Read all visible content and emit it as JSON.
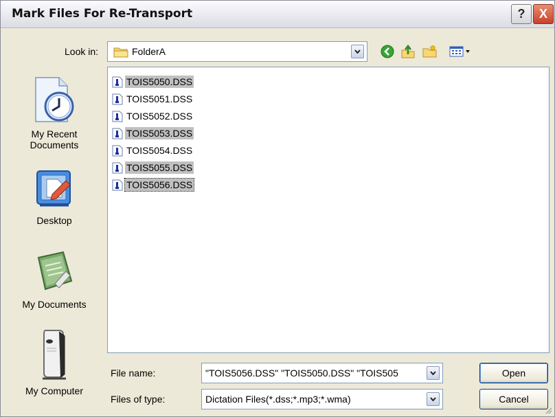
{
  "window": {
    "title": "Mark Files For Re-Transport"
  },
  "titlebar_buttons": {
    "help": "?",
    "close": "X"
  },
  "look_in": {
    "label": "Look in:",
    "value": "FolderA"
  },
  "toolbar": {
    "icons": [
      "back-icon",
      "up-folder-icon",
      "new-folder-icon",
      "view-menu-icon"
    ]
  },
  "places": [
    {
      "label_line1": "My Recent",
      "label_line2": "Documents"
    },
    {
      "label_line1": "Desktop",
      "label_line2": ""
    },
    {
      "label_line1": "My Documents",
      "label_line2": ""
    },
    {
      "label_line1": "My Computer",
      "label_line2": ""
    }
  ],
  "files": [
    {
      "name": "TOIS5050.DSS",
      "selected": true
    },
    {
      "name": "TOIS5051.DSS",
      "selected": false
    },
    {
      "name": "TOIS5052.DSS",
      "selected": false
    },
    {
      "name": "TOIS5053.DSS",
      "selected": true
    },
    {
      "name": "TOIS5054.DSS",
      "selected": false
    },
    {
      "name": "TOIS5055.DSS",
      "selected": true
    },
    {
      "name": "TOIS5056.DSS",
      "selected": true
    }
  ],
  "file_name": {
    "label": "File name:",
    "value": "\"TOIS5056.DSS\" \"TOIS5050.DSS\" \"TOIS505"
  },
  "file_type": {
    "label": "Files of type:",
    "value": "Dictation Files(*.dss;*.mp3;*.wma)"
  },
  "buttons": {
    "open": "Open",
    "cancel": "Cancel"
  },
  "colors": {
    "selection": "#c0c0c0",
    "field_border": "#7f9db9",
    "dialog_bg": "#ece9d8"
  }
}
